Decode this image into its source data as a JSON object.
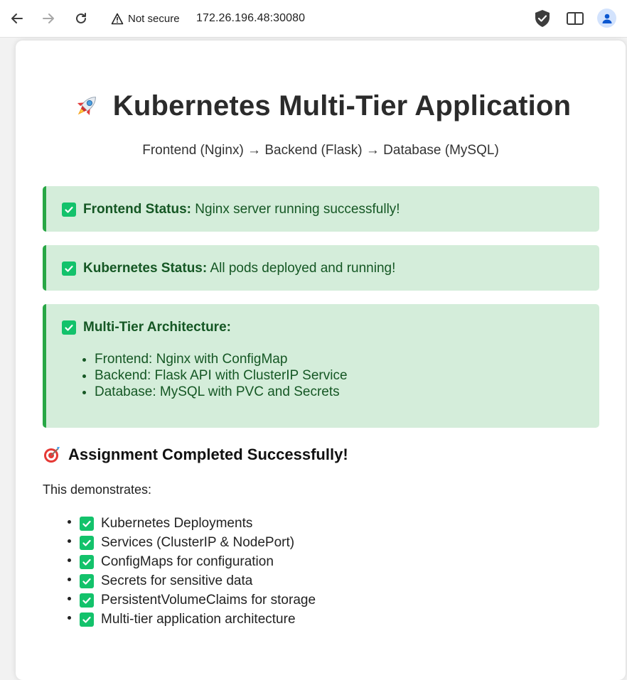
{
  "browser": {
    "security_label": "Not secure",
    "url": "172.26.196.48:30080"
  },
  "page": {
    "title_icon": "rocket-icon",
    "title": "Kubernetes Multi-Tier Application",
    "subtitle": "Frontend (Nginx) → Backend (Flask) → Database (MySQL)",
    "statuses": [
      {
        "label": "Frontend Status:",
        "text": "Nginx server running successfully!"
      },
      {
        "label": "Kubernetes Status:",
        "text": "All pods deployed and running!"
      },
      {
        "label": "Multi-Tier Architecture:",
        "items": [
          "Frontend: Nginx with ConfigMap",
          "Backend: Flask API with ClusterIP Service",
          "Database: MySQL with PVC and Secrets"
        ]
      }
    ],
    "completed_icon": "target-icon",
    "completed_title": "Assignment Completed Successfully!",
    "demo_intro": "This demonstrates:",
    "demo_items": [
      "Kubernetes Deployments",
      "Services (ClusterIP & NodePort)",
      "ConfigMaps for configuration",
      "Secrets for sensitive data",
      "PersistentVolumeClaims for storage",
      "Multi-tier application architecture"
    ]
  },
  "colors": {
    "status_bg": "#d4edda",
    "status_border": "#28a745",
    "status_text": "#155724",
    "check_green": "#13c26b"
  }
}
